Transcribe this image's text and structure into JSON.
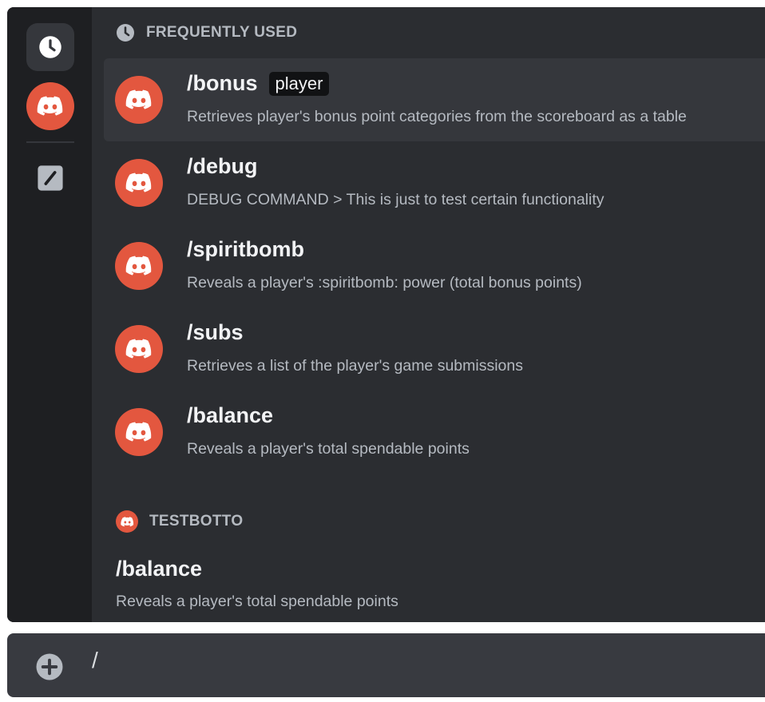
{
  "rail": {
    "items": [
      {
        "icon": "clock-icon",
        "label": "Frequently Used"
      },
      {
        "icon": "discord-bot-icon",
        "label": "TESTBOTTO"
      },
      {
        "icon": "slash-icon",
        "label": "Built-in"
      }
    ]
  },
  "sections": {
    "frequently_used": {
      "title": "FREQUENTLY USED",
      "commands": [
        {
          "name": "/bonus",
          "param": "player",
          "desc": "Retrieves player's bonus point categories from the scoreboard as a table"
        },
        {
          "name": "/debug",
          "desc": "DEBUG COMMAND > This is just to test certain functionality"
        },
        {
          "name": "/spiritbomb",
          "desc": "Reveals a player's :spiritbomb: power (total bonus points)"
        },
        {
          "name": "/subs",
          "desc": "Retrieves a list of the player's game submissions"
        },
        {
          "name": "/balance",
          "desc": "Reveals a player's total spendable points"
        }
      ]
    },
    "testbotto": {
      "title": "TESTBOTTO",
      "commands": [
        {
          "name": "/balance",
          "desc": "Reveals a player's total spendable points"
        }
      ]
    }
  },
  "chat": {
    "value": "/"
  },
  "colors": {
    "accent": "#e3573f",
    "background": "#2b2d31",
    "rail": "#1e1f22",
    "selected": "#35373c",
    "chatbar": "#383a40"
  }
}
